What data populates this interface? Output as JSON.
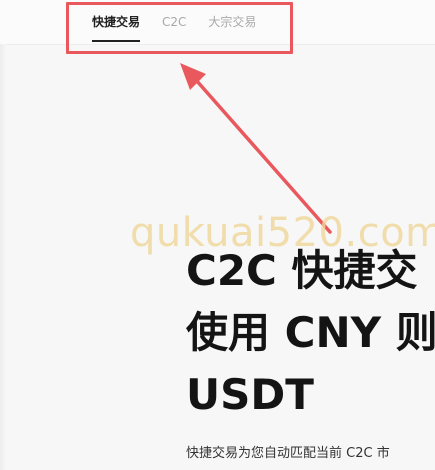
{
  "tabs": [
    {
      "label": "快捷交易",
      "active": true
    },
    {
      "label": "C2C",
      "active": false
    },
    {
      "label": "大宗交易",
      "active": false
    }
  ],
  "watermark": "qukuai520.com",
  "hero": {
    "line1": "C2C 快捷交",
    "line2": "使用 CNY 则",
    "line3": "USDT"
  },
  "description": "快捷交易为您自动匹配当前 C2C 市",
  "colors": {
    "highlight": "#e8585d",
    "active_tab": "#222222",
    "inactive_tab": "#a8a8a8",
    "watermark": "#eed696"
  }
}
